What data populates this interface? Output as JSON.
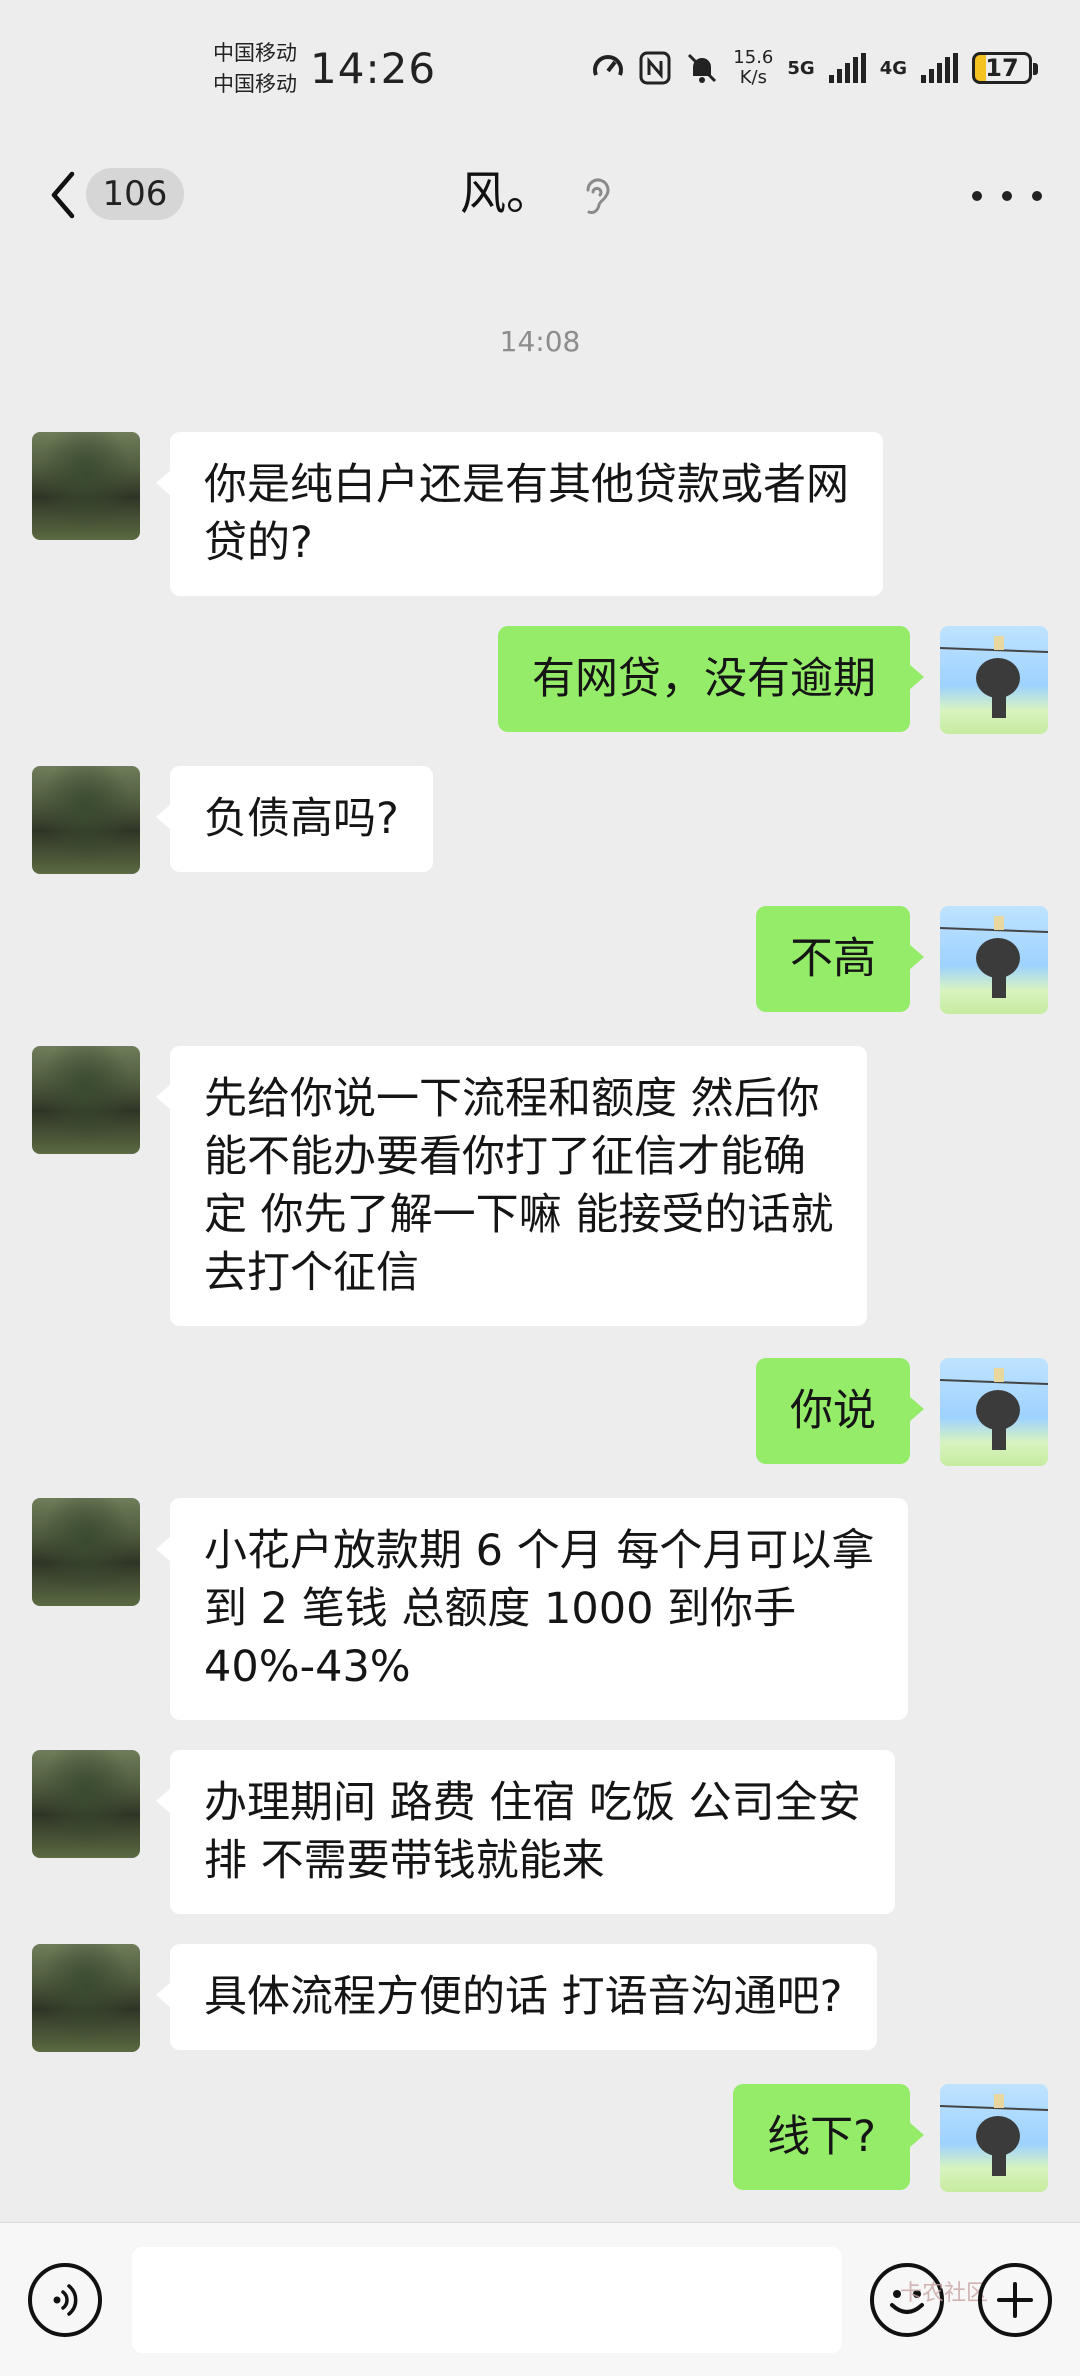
{
  "status_bar": {
    "carrier_1": "中国移动",
    "carrier_2": "中国移动",
    "time": "14:26",
    "speed_value": "15.6",
    "speed_unit": "K/s",
    "net_1": "5G",
    "net_2": "4G",
    "battery": "17"
  },
  "header": {
    "unread_count": "106",
    "title": "风。"
  },
  "chat": {
    "timestamp": "14:08",
    "messages": [
      {
        "side": "in",
        "text": "你是纯白户还是有其他贷款或者网\n贷的?"
      },
      {
        "side": "out",
        "text": "有网贷，没有逾期"
      },
      {
        "side": "in",
        "text": "负债高吗?"
      },
      {
        "side": "out",
        "text": "不高"
      },
      {
        "side": "in",
        "text": "先给你说一下流程和额度 然后你\n能不能办要看你打了征信才能确\n定 你先了解一下嘛 能接受的话就\n去打个征信"
      },
      {
        "side": "out",
        "text": "你说"
      },
      {
        "side": "in",
        "text": "小花户放款期 6 个月 每个月可以拿\n到 2 笔钱 总额度 1000 到你手\n40%-43%"
      },
      {
        "side": "in",
        "text": "办理期间 路费 住宿 吃饭 公司全安\n排 不需要带钱就能来"
      },
      {
        "side": "in",
        "text": "具体流程方便的话 打语音沟通吧?"
      },
      {
        "side": "out",
        "text": "线下?"
      }
    ]
  },
  "input_bar": {
    "placeholder": "",
    "watermark": "卡农社区"
  },
  "colors": {
    "background": "#ededed",
    "outgoing_bubble": "#95ec69",
    "incoming_bubble": "#ffffff"
  },
  "icons": {
    "back": "chevron-left-icon",
    "ear": "ear-icon",
    "more": "more-dots-icon",
    "voice": "voice-icon",
    "emoji": "emoji-icon",
    "plus": "plus-icon"
  }
}
